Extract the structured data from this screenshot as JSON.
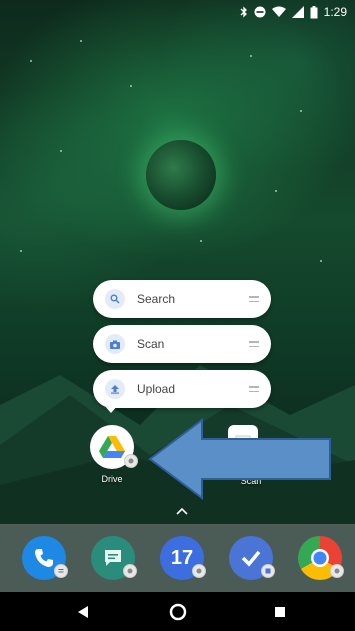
{
  "status_bar": {
    "time": "1:29",
    "icons": [
      "bluetooth-icon",
      "do-not-disturb-icon",
      "wifi-icon",
      "signal-icon",
      "battery-icon"
    ]
  },
  "shortcut_menu": {
    "items": [
      {
        "label": "Search",
        "icon": "search-icon"
      },
      {
        "label": "Scan",
        "icon": "camera-icon"
      },
      {
        "label": "Upload",
        "icon": "upload-icon"
      }
    ]
  },
  "home_apps": {
    "drive_label": "Drive",
    "scan_label": "Scan"
  },
  "dock": {
    "apps": [
      {
        "name": "phone",
        "icon": "phone-icon"
      },
      {
        "name": "messages",
        "icon": "message-icon"
      },
      {
        "name": "calendar",
        "icon": "calendar-icon",
        "day": "17"
      },
      {
        "name": "inbox",
        "icon": "checkmark-icon"
      },
      {
        "name": "chrome",
        "icon": "chrome-icon"
      }
    ]
  },
  "colors": {
    "arrow": "#5b8fc7",
    "drive_yellow": "#fbbc04",
    "drive_green": "#34a853",
    "drive_blue": "#4285f4",
    "phone_blue": "#1e88e5",
    "messages_teal": "#2a8c7b",
    "calendar_blue": "#3d6ee0",
    "inbox_blue": "#4a74d6"
  }
}
